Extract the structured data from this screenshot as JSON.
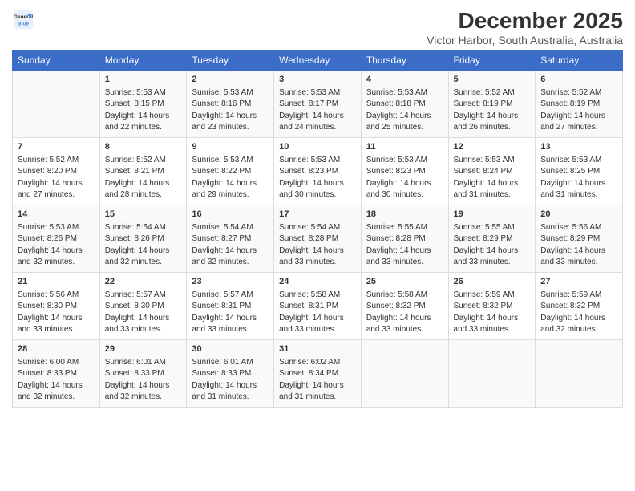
{
  "header": {
    "logo_line1": "General",
    "logo_line2": "Blue",
    "title": "December 2025",
    "subtitle": "Victor Harbor, South Australia, Australia"
  },
  "weekdays": [
    "Sunday",
    "Monday",
    "Tuesday",
    "Wednesday",
    "Thursday",
    "Friday",
    "Saturday"
  ],
  "weeks": [
    [
      {
        "day": "",
        "sunrise": "",
        "sunset": "",
        "daylight": ""
      },
      {
        "day": "1",
        "sunrise": "Sunrise: 5:53 AM",
        "sunset": "Sunset: 8:15 PM",
        "daylight": "Daylight: 14 hours and 22 minutes."
      },
      {
        "day": "2",
        "sunrise": "Sunrise: 5:53 AM",
        "sunset": "Sunset: 8:16 PM",
        "daylight": "Daylight: 14 hours and 23 minutes."
      },
      {
        "day": "3",
        "sunrise": "Sunrise: 5:53 AM",
        "sunset": "Sunset: 8:17 PM",
        "daylight": "Daylight: 14 hours and 24 minutes."
      },
      {
        "day": "4",
        "sunrise": "Sunrise: 5:53 AM",
        "sunset": "Sunset: 8:18 PM",
        "daylight": "Daylight: 14 hours and 25 minutes."
      },
      {
        "day": "5",
        "sunrise": "Sunrise: 5:52 AM",
        "sunset": "Sunset: 8:19 PM",
        "daylight": "Daylight: 14 hours and 26 minutes."
      },
      {
        "day": "6",
        "sunrise": "Sunrise: 5:52 AM",
        "sunset": "Sunset: 8:19 PM",
        "daylight": "Daylight: 14 hours and 27 minutes."
      }
    ],
    [
      {
        "day": "7",
        "sunrise": "Sunrise: 5:52 AM",
        "sunset": "Sunset: 8:20 PM",
        "daylight": "Daylight: 14 hours and 27 minutes."
      },
      {
        "day": "8",
        "sunrise": "Sunrise: 5:52 AM",
        "sunset": "Sunset: 8:21 PM",
        "daylight": "Daylight: 14 hours and 28 minutes."
      },
      {
        "day": "9",
        "sunrise": "Sunrise: 5:53 AM",
        "sunset": "Sunset: 8:22 PM",
        "daylight": "Daylight: 14 hours and 29 minutes."
      },
      {
        "day": "10",
        "sunrise": "Sunrise: 5:53 AM",
        "sunset": "Sunset: 8:23 PM",
        "daylight": "Daylight: 14 hours and 30 minutes."
      },
      {
        "day": "11",
        "sunrise": "Sunrise: 5:53 AM",
        "sunset": "Sunset: 8:23 PM",
        "daylight": "Daylight: 14 hours and 30 minutes."
      },
      {
        "day": "12",
        "sunrise": "Sunrise: 5:53 AM",
        "sunset": "Sunset: 8:24 PM",
        "daylight": "Daylight: 14 hours and 31 minutes."
      },
      {
        "day": "13",
        "sunrise": "Sunrise: 5:53 AM",
        "sunset": "Sunset: 8:25 PM",
        "daylight": "Daylight: 14 hours and 31 minutes."
      }
    ],
    [
      {
        "day": "14",
        "sunrise": "Sunrise: 5:53 AM",
        "sunset": "Sunset: 8:26 PM",
        "daylight": "Daylight: 14 hours and 32 minutes."
      },
      {
        "day": "15",
        "sunrise": "Sunrise: 5:54 AM",
        "sunset": "Sunset: 8:26 PM",
        "daylight": "Daylight: 14 hours and 32 minutes."
      },
      {
        "day": "16",
        "sunrise": "Sunrise: 5:54 AM",
        "sunset": "Sunset: 8:27 PM",
        "daylight": "Daylight: 14 hours and 32 minutes."
      },
      {
        "day": "17",
        "sunrise": "Sunrise: 5:54 AM",
        "sunset": "Sunset: 8:28 PM",
        "daylight": "Daylight: 14 hours and 33 minutes."
      },
      {
        "day": "18",
        "sunrise": "Sunrise: 5:55 AM",
        "sunset": "Sunset: 8:28 PM",
        "daylight": "Daylight: 14 hours and 33 minutes."
      },
      {
        "day": "19",
        "sunrise": "Sunrise: 5:55 AM",
        "sunset": "Sunset: 8:29 PM",
        "daylight": "Daylight: 14 hours and 33 minutes."
      },
      {
        "day": "20",
        "sunrise": "Sunrise: 5:56 AM",
        "sunset": "Sunset: 8:29 PM",
        "daylight": "Daylight: 14 hours and 33 minutes."
      }
    ],
    [
      {
        "day": "21",
        "sunrise": "Sunrise: 5:56 AM",
        "sunset": "Sunset: 8:30 PM",
        "daylight": "Daylight: 14 hours and 33 minutes."
      },
      {
        "day": "22",
        "sunrise": "Sunrise: 5:57 AM",
        "sunset": "Sunset: 8:30 PM",
        "daylight": "Daylight: 14 hours and 33 minutes."
      },
      {
        "day": "23",
        "sunrise": "Sunrise: 5:57 AM",
        "sunset": "Sunset: 8:31 PM",
        "daylight": "Daylight: 14 hours and 33 minutes."
      },
      {
        "day": "24",
        "sunrise": "Sunrise: 5:58 AM",
        "sunset": "Sunset: 8:31 PM",
        "daylight": "Daylight: 14 hours and 33 minutes."
      },
      {
        "day": "25",
        "sunrise": "Sunrise: 5:58 AM",
        "sunset": "Sunset: 8:32 PM",
        "daylight": "Daylight: 14 hours and 33 minutes."
      },
      {
        "day": "26",
        "sunrise": "Sunrise: 5:59 AM",
        "sunset": "Sunset: 8:32 PM",
        "daylight": "Daylight: 14 hours and 33 minutes."
      },
      {
        "day": "27",
        "sunrise": "Sunrise: 5:59 AM",
        "sunset": "Sunset: 8:32 PM",
        "daylight": "Daylight: 14 hours and 32 minutes."
      }
    ],
    [
      {
        "day": "28",
        "sunrise": "Sunrise: 6:00 AM",
        "sunset": "Sunset: 8:33 PM",
        "daylight": "Daylight: 14 hours and 32 minutes."
      },
      {
        "day": "29",
        "sunrise": "Sunrise: 6:01 AM",
        "sunset": "Sunset: 8:33 PM",
        "daylight": "Daylight: 14 hours and 32 minutes."
      },
      {
        "day": "30",
        "sunrise": "Sunrise: 6:01 AM",
        "sunset": "Sunset: 8:33 PM",
        "daylight": "Daylight: 14 hours and 31 minutes."
      },
      {
        "day": "31",
        "sunrise": "Sunrise: 6:02 AM",
        "sunset": "Sunset: 8:34 PM",
        "daylight": "Daylight: 14 hours and 31 minutes."
      },
      {
        "day": "",
        "sunrise": "",
        "sunset": "",
        "daylight": ""
      },
      {
        "day": "",
        "sunrise": "",
        "sunset": "",
        "daylight": ""
      },
      {
        "day": "",
        "sunrise": "",
        "sunset": "",
        "daylight": ""
      }
    ]
  ]
}
